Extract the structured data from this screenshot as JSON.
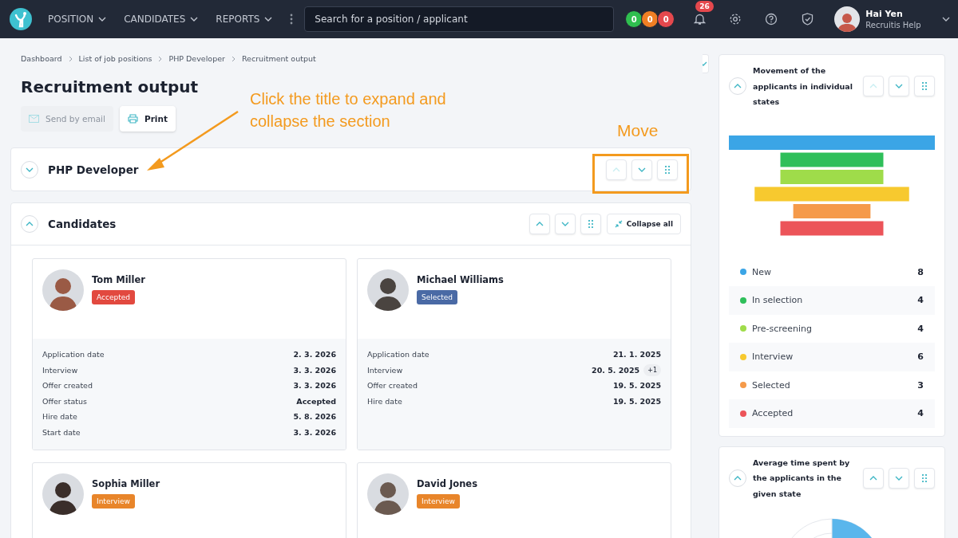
{
  "nav": {
    "menus": [
      {
        "label": "POSITION"
      },
      {
        "label": "CANDIDATES"
      },
      {
        "label": "REPORTS"
      }
    ],
    "search": {
      "placeholder": "Search for a position / applicant"
    },
    "counters": [
      {
        "value": "0",
        "color": "#2fbf4f"
      },
      {
        "value": "0",
        "color": "#f07f24"
      },
      {
        "value": "0",
        "color": "#e5484d"
      }
    ],
    "notifications": "26",
    "user": {
      "name": "Hai Yen",
      "org": "Recruitis Help"
    }
  },
  "breadcrumbs": [
    "Dashboard",
    "List of job positions",
    "PHP Developer",
    "Recruitment output"
  ],
  "title": "Recruitment output",
  "actions": [
    {
      "label": "Send by email",
      "disabled": true,
      "kind": "email"
    },
    {
      "label": "Print",
      "disabled": false,
      "kind": "print"
    }
  ],
  "annotations": {
    "hint": "Click the title to expand and collapse the section",
    "move": "Move"
  },
  "position_section": {
    "title": "PHP Developer",
    "expanded": false
  },
  "candidates_section": {
    "title": "Candidates",
    "expanded": true,
    "collapse_all": "Collapse all",
    "cards": [
      {
        "name": "Tom Miller",
        "status": "Accepted",
        "color": "#e2493f",
        "rows": [
          {
            "label": "Application date",
            "value": "2. 3. 2026"
          },
          {
            "label": "Interview",
            "value": "3. 3. 2026"
          },
          {
            "label": "Offer created",
            "value": "3. 3. 2026"
          },
          {
            "label": "Offer status",
            "value": "Accepted"
          },
          {
            "label": "Hire date",
            "value": "5. 8. 2026"
          },
          {
            "label": "Start date",
            "value": "3. 3. 2026"
          }
        ]
      },
      {
        "name": "Michael Williams",
        "status": "Selected",
        "color": "#4a6aa5",
        "rows": [
          {
            "label": "Application date",
            "value": "21. 1. 2025"
          },
          {
            "label": "Interview",
            "value": "20. 5. 2025",
            "extra": "+1"
          },
          {
            "label": "Offer created",
            "value": "19. 5. 2025"
          },
          {
            "label": "Hire date",
            "value": "19. 5. 2025"
          }
        ]
      },
      {
        "name": "Sophia Miller",
        "status": "Interview",
        "color": "#e8852a"
      },
      {
        "name": "David Jones",
        "status": "Interview",
        "color": "#e8852a"
      }
    ]
  },
  "sidebar": {
    "movement": {
      "title": "Movement of the applicants in individual states",
      "expanded": true,
      "states": [
        {
          "name": "New",
          "count": "8",
          "color": "#3ba5e6"
        },
        {
          "name": "In selection",
          "count": "4",
          "color": "#2fbf5a"
        },
        {
          "name": "Pre-screening",
          "count": "4",
          "color": "#9fdc4a"
        },
        {
          "name": "Interview",
          "count": "6",
          "color": "#f7c92f"
        },
        {
          "name": "Selected",
          "count": "3",
          "color": "#f59a4a"
        },
        {
          "name": "Accepted",
          "count": "4",
          "color": "#ec5459"
        }
      ]
    },
    "average": {
      "title": "Average time spent by the applicants in the given state",
      "expanded": true
    }
  }
}
